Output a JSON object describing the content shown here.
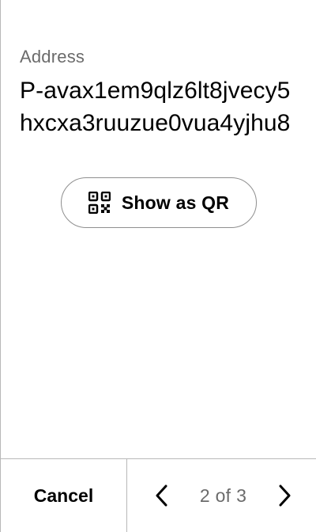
{
  "address": {
    "label": "Address",
    "value": "P-avax1em9qlz6lt8jvecy5hxcxa3ruuzue0vua4yjhu8"
  },
  "qr_button": {
    "label": "Show as QR",
    "icon": "qr-code-icon"
  },
  "footer": {
    "cancel_label": "Cancel",
    "page_indicator": "2 of 3",
    "prev_icon": "chevron-left-icon",
    "next_icon": "chevron-right-icon"
  },
  "colors": {
    "text_primary": "#000000",
    "text_secondary": "#6b6b6b",
    "border": "#b8b8b8",
    "button_border": "#8f8f8f"
  }
}
